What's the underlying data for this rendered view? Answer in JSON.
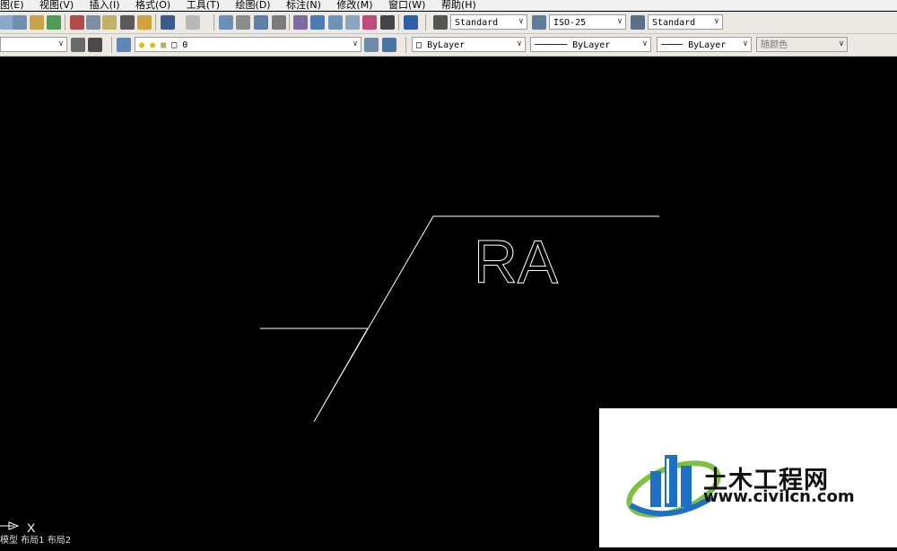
{
  "menu": {
    "items": [
      "图(E)",
      "视图(V)",
      "插入(I)",
      "格式(O)",
      "工具(T)",
      "绘图(D)",
      "标注(N)",
      "修改(M)",
      "窗口(W)",
      "帮助(H)"
    ]
  },
  "styles": {
    "text_style": "Standard",
    "dim_style": "ISO-25",
    "table_style": "Standard"
  },
  "properties": {
    "layer": "0",
    "color": "ByLayer",
    "linetype": "ByLayer",
    "lineweight": "ByLayer",
    "plot_style": "随颜色"
  },
  "drawing": {
    "text_label": "RA",
    "line_color": "#ffffff"
  },
  "ucs": {
    "x_label": "X"
  },
  "status": {
    "tabs": "模型 布局1 布局2"
  },
  "watermark": {
    "site_name": "土木工程网",
    "url": "www.civilcn.com",
    "logo_blue": "#1f6fc4",
    "logo_green": "#7bc142"
  }
}
